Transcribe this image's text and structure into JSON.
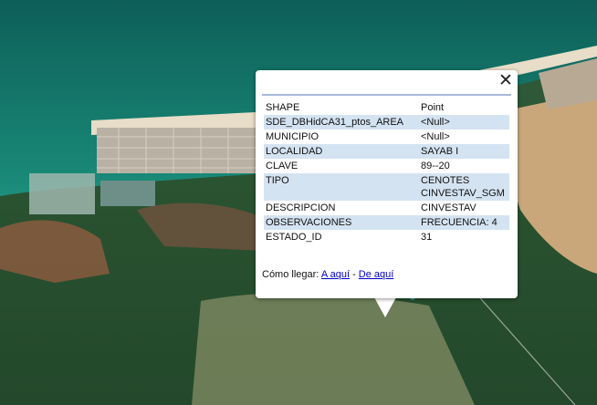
{
  "popup": {
    "close_icon": "close-icon",
    "attributes": [
      {
        "key": "SHAPE",
        "value": "Point"
      },
      {
        "key": "SDE_DBHidCA31_ptos_AREA",
        "value": "<Null>"
      },
      {
        "key": "MUNICIPIO",
        "value": "<Null>"
      },
      {
        "key": "LOCALIDAD",
        "value": "SAYAB I"
      },
      {
        "key": "CLAVE",
        "value": "89--20"
      },
      {
        "key": "TIPO",
        "value": "CENOTES\nCINVESTAV_SGM"
      },
      {
        "key": "DESCRIPCION",
        "value": "CINVESTAV"
      },
      {
        "key": "OBSERVACIONES",
        "value": "FRECUENCIA: 4"
      },
      {
        "key": "ESTADO_ID",
        "value": "31"
      }
    ],
    "directions": {
      "label": "Cómo llegar:",
      "to_here": "A aquí",
      "separator": " - ",
      "from_here": "De aquí"
    }
  },
  "colors": {
    "table_stripe": "#d4e3f1",
    "link": "#0000cc",
    "header_rule": "#a6badb"
  }
}
